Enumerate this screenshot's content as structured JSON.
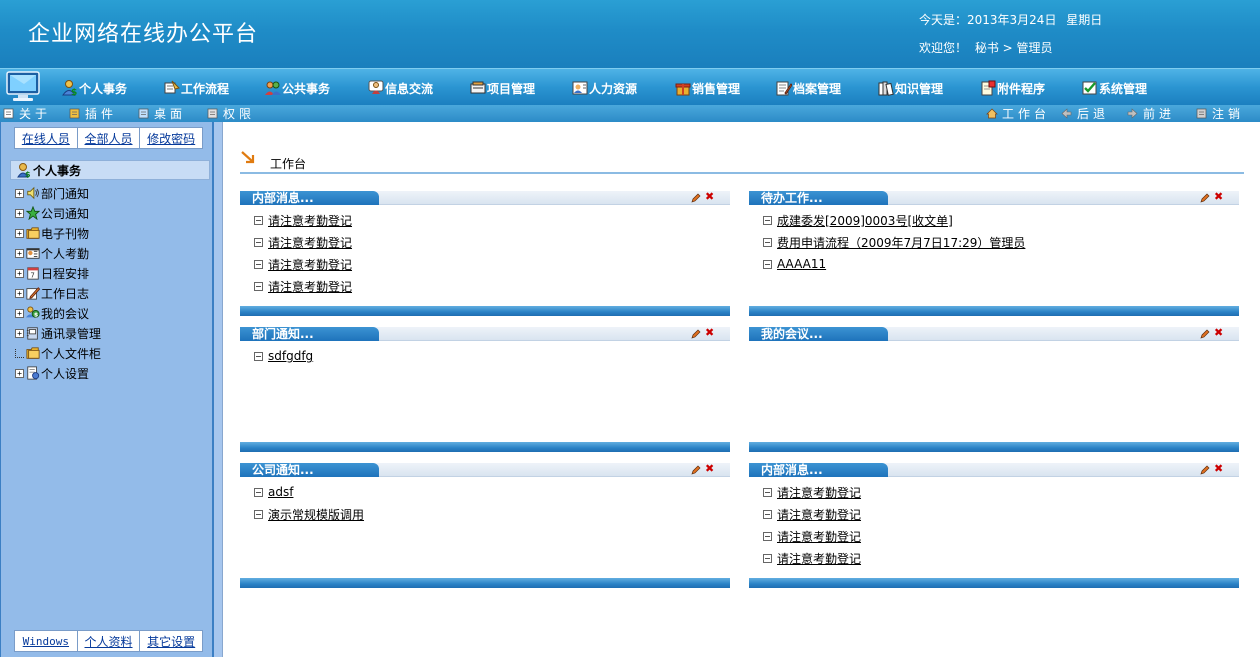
{
  "header": {
    "title": "企业网络在线办公平台",
    "date_label": "今天是：2013年3月24日",
    "weekday": "星期日",
    "welcome": "欢迎您！",
    "user_role": "秘书 > 管理员"
  },
  "main_menu": [
    {
      "label": "个人事务",
      "icon": "person-money-icon"
    },
    {
      "label": "工作流程",
      "icon": "workflow-icon"
    },
    {
      "label": "公共事务",
      "icon": "people-icon"
    },
    {
      "label": "信息交流",
      "icon": "chat-user-icon"
    },
    {
      "label": "项目管理",
      "icon": "project-icon"
    },
    {
      "label": "人力资源",
      "icon": "hr-icon"
    },
    {
      "label": "销售管理",
      "icon": "gift-icon"
    },
    {
      "label": "档案管理",
      "icon": "archive-edit-icon"
    },
    {
      "label": "知识管理",
      "icon": "books-icon"
    },
    {
      "label": "附件程序",
      "icon": "attachment-icon"
    },
    {
      "label": "系统管理",
      "icon": "system-check-icon"
    }
  ],
  "sub_toolbar": {
    "left": [
      "关于",
      "插件",
      "桌面",
      "权限"
    ],
    "right": [
      "工作台",
      "后退",
      "前进",
      "注销"
    ]
  },
  "left_panel": {
    "top_tabs": [
      "在线人员",
      "全部人员",
      "修改密码"
    ],
    "bottom_tabs": [
      "Windows",
      "个人资料",
      "其它设置"
    ],
    "tree_root": "个人事务",
    "tree_items": [
      {
        "label": "部门通知",
        "icon": "speaker-icon",
        "expandable": true
      },
      {
        "label": "公司通知",
        "icon": "star-icon",
        "expandable": true
      },
      {
        "label": "电子刊物",
        "icon": "folder-icon",
        "expandable": true
      },
      {
        "label": "个人考勤",
        "icon": "attendance-icon",
        "expandable": true
      },
      {
        "label": "日程安排",
        "icon": "calendar-icon",
        "expandable": true
      },
      {
        "label": "工作日志",
        "icon": "pencil-note-icon",
        "expandable": true
      },
      {
        "label": "我的会议",
        "icon": "meeting-icon",
        "expandable": true
      },
      {
        "label": "通讯录管理",
        "icon": "address-book-icon",
        "expandable": true
      },
      {
        "label": "个人文件柜",
        "icon": "folder-icon",
        "expandable": false
      },
      {
        "label": "个人设置",
        "icon": "settings-doc-icon",
        "expandable": true
      }
    ]
  },
  "content": {
    "breadcrumb": "工作台",
    "panels": [
      {
        "title": "内部消息...",
        "items": [
          "请注意考勤登记",
          "请注意考勤登记",
          "请注意考勤登记",
          "请注意考勤登记"
        ]
      },
      {
        "title": "待办工作...",
        "items": [
          "成建委发[2009]0003号[收文单]",
          "费用申请流程（2009年7月7日17:29）管理员",
          "AAAA11"
        ]
      },
      {
        "title": "部门通知...",
        "items": [
          "sdfgdfg"
        ]
      },
      {
        "title": "我的会议...",
        "items": []
      },
      {
        "title": "公司通知...",
        "items": [
          "adsf",
          "演示常规模版调用"
        ]
      },
      {
        "title": "内部消息...",
        "items": [
          "请注意考勤登记",
          "请注意考勤登记",
          "请注意考勤登记",
          "请注意考勤登记"
        ]
      }
    ],
    "close_symbol": "✖"
  },
  "colors": {
    "header_blue": "#1f8cc7",
    "panel_title_blue": "#1e73bb",
    "left_panel_bg": "#93bbe9",
    "link_blue": "#063a9b"
  }
}
